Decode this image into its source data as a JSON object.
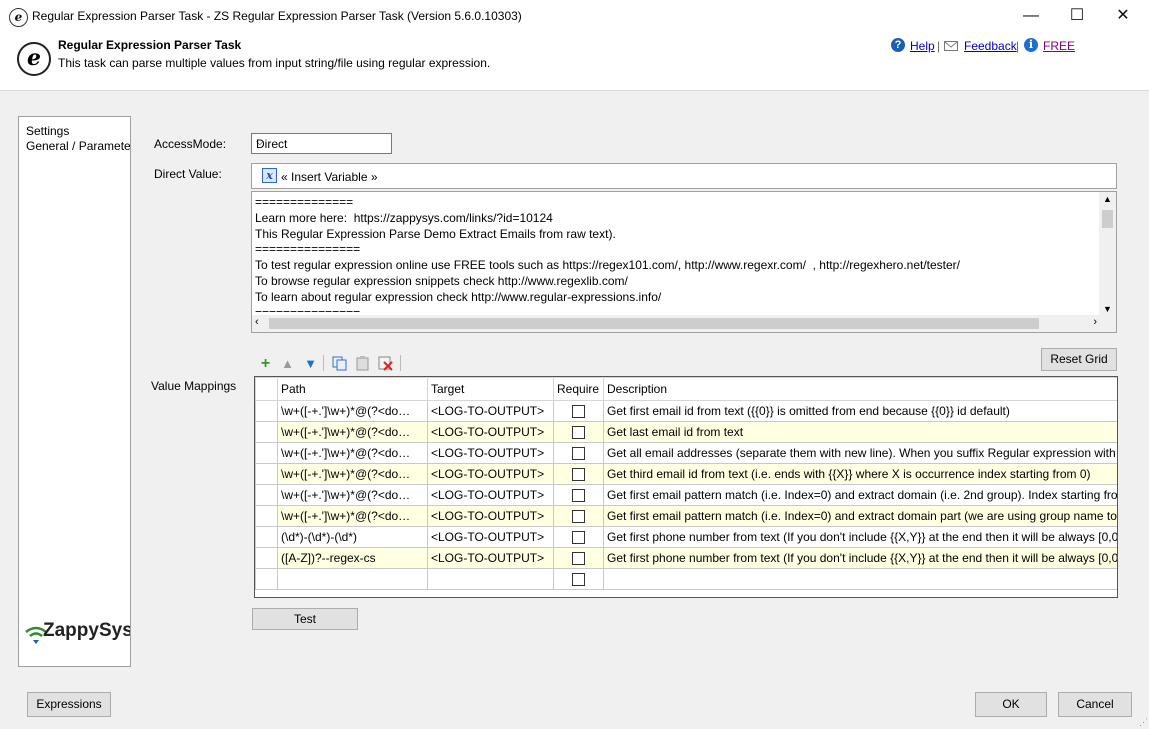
{
  "window": {
    "title": "Regular Expression Parser Task - ZS Regular Expression Parser Task (Version 5.6.0.10303)",
    "controls": {
      "minimize": "—",
      "maximize": "☐",
      "close": "✕"
    }
  },
  "header": {
    "title": "Regular Expression Parser Task",
    "description": "This task can parse multiple values from input string/file using regular expression.",
    "links": {
      "help": "Help",
      "feedback": "Feedback",
      "free": "FREE"
    },
    "separator": "|"
  },
  "sidebar": {
    "items": [
      {
        "label": "Settings"
      },
      {
        "label": "General / Parameters"
      }
    ]
  },
  "access_mode": {
    "label": "AccessMode:",
    "value": "Direct"
  },
  "direct_value": {
    "label": "Direct Value:",
    "insert_variable": "« Insert Variable »",
    "lines": [
      "==============",
      "Learn more here:  https://zappysys.com/links/?id=10124",
      "This Regular Expression Parse Demo Extract Emails from raw text).",
      "===============",
      "To test regular expression online use FREE tools such as https://regex101.com/, http://www.regexr.com/  , http://regexhero.net/tester/",
      "To browse regular expression snippets check http://www.regexlib.com/",
      "To learn about regular expression check http://www.regular-expressions.info/",
      "==============="
    ]
  },
  "value_mappings": {
    "label": "Value Mappings",
    "reset_grid": "Reset Grid",
    "columns": {
      "path": "Path",
      "target": "Target",
      "require": "Require",
      "description": "Description"
    },
    "rows": [
      {
        "path": "\\w+([-+.']\\w+)*@(?<do…",
        "target": "<LOG-TO-OUTPUT>",
        "description": "Get first email id from text ({{0}} is omitted from end because {{0}} id default)"
      },
      {
        "path": "\\w+([-+.']\\w+)*@(?<do…",
        "target": "<LOG-TO-OUTPUT>",
        "description": "Get last email id from text"
      },
      {
        "path": "\\w+([-+.']\\w+)*@(?<do…",
        "target": "<LOG-TO-OUTPUT>",
        "description": "Get all email addresses (separate them with new line). When you suffix Regular expression with {{"
      },
      {
        "path": "\\w+([-+.']\\w+)*@(?<do…",
        "target": "<LOG-TO-OUTPUT>",
        "description": "Get third email id from text (i.e. ends with {{X}} where X is occurrence index starting from 0)"
      },
      {
        "path": "\\w+([-+.']\\w+)*@(?<do…",
        "target": "<LOG-TO-OUTPUT>",
        "description": "Get first email pattern match (i.e. Index=0) and extract domain (i.e. 2nd group). Index starting fro"
      },
      {
        "path": "\\w+([-+.']\\w+)*@(?<do…",
        "target": "<LOG-TO-OUTPUT>",
        "description": "Get first email pattern match (i.e. Index=0) and extract domain part (we are using group name to"
      },
      {
        "path": "(\\d*)-(\\d*)-(\\d*)",
        "target": "<LOG-TO-OUTPUT>",
        "description": "Get first phone number from text (If you don't include {{X,Y}} at the end then it will be always [0,0"
      },
      {
        "path": "([A-Z])?--regex-cs",
        "target": "<LOG-TO-OUTPUT>",
        "description": "Get first phone number from text (If you don't include {{X,Y}} at the end then it will be always [0,0"
      },
      {
        "path": "",
        "target": "",
        "description": ""
      }
    ]
  },
  "buttons": {
    "test": "Test",
    "expressions": "Expressions",
    "ok": "OK",
    "cancel": "Cancel"
  },
  "brand": {
    "logo_text": "ZappySys"
  },
  "colors": {
    "link": "#0000cc",
    "free_link": "#800080",
    "alt_row": "#ffffe1",
    "help_icon": "#1a5fb4",
    "info_icon": "#1f6fd1"
  }
}
